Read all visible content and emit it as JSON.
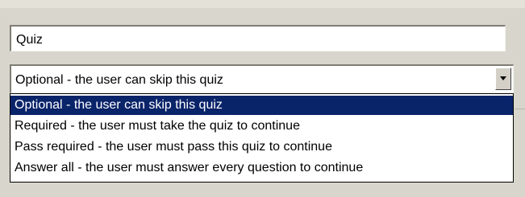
{
  "title_field": {
    "value": "Quiz"
  },
  "quiz_mode_select": {
    "selected_label": "Optional - the user can skip this quiz",
    "options": [
      "Optional - the user can skip this quiz",
      "Required - the user must take the quiz to continue",
      "Pass required - the user must pass this quiz to continue",
      "Answer all - the user must answer every question to continue"
    ],
    "highlighted_index": 0
  },
  "icons": {
    "dropdown_arrow": "chevron-down-icon"
  },
  "colors": {
    "background": "#d8d6cc",
    "highlight": "#0a246a",
    "highlight_text": "#ffffff"
  }
}
